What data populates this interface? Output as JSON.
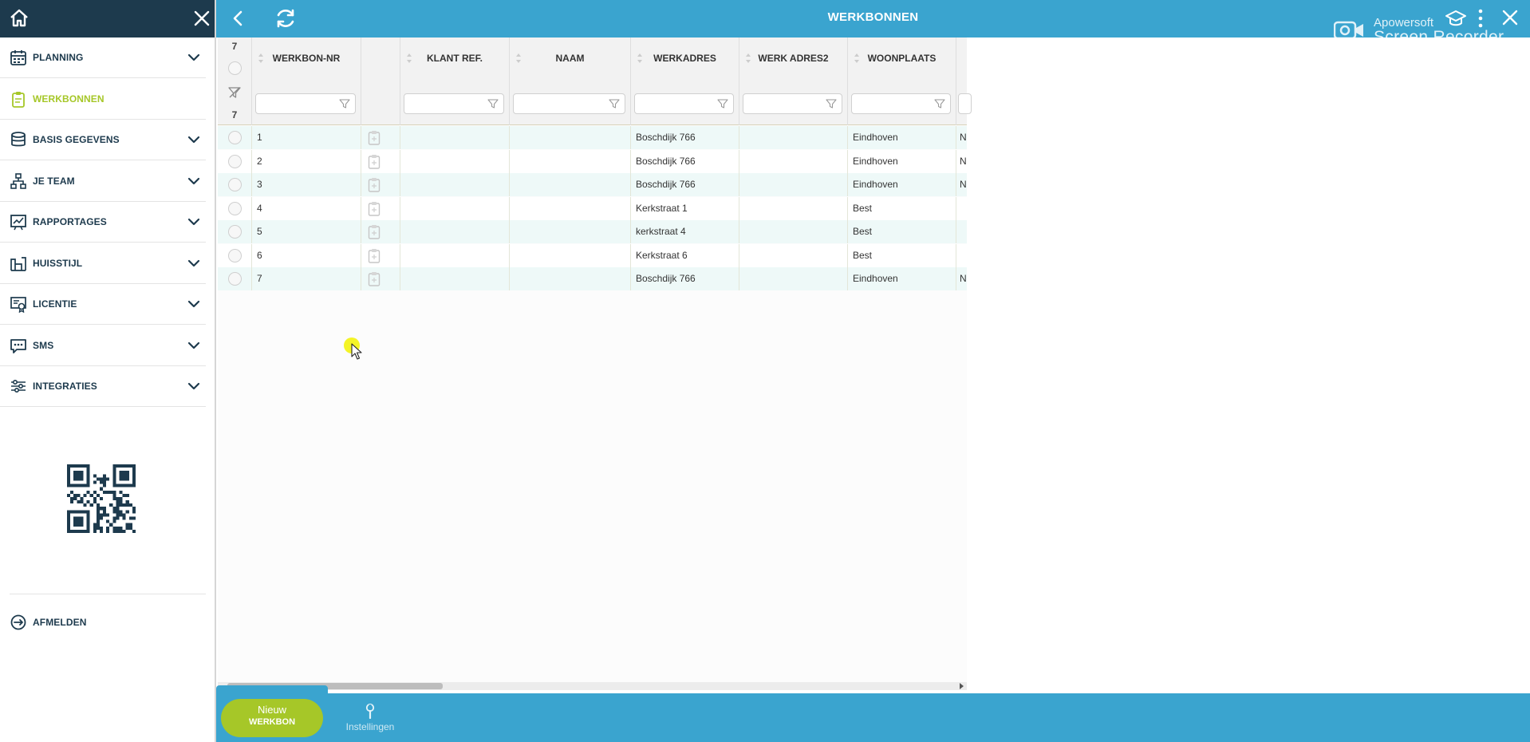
{
  "header": {
    "title": "WERKBONNEN"
  },
  "watermark": {
    "line1": "Apowersoft",
    "line2": "Screen Recorder"
  },
  "sidebar": {
    "items": [
      {
        "label": "PLANNING",
        "icon": "calendar-icon",
        "has_chevron": true
      },
      {
        "label": "WERKBONNEN",
        "icon": "clipboard-icon",
        "has_chevron": false,
        "active": true
      },
      {
        "label": "BASIS GEGEVENS",
        "icon": "database-icon",
        "has_chevron": true
      },
      {
        "label": "JE TEAM",
        "icon": "org-chart-icon",
        "has_chevron": true
      },
      {
        "label": "RAPPORTAGES",
        "icon": "report-icon",
        "has_chevron": true
      },
      {
        "label": "HUISSTIJL",
        "icon": "brand-icon",
        "has_chevron": true
      },
      {
        "label": "LICENTIE",
        "icon": "certificate-icon",
        "has_chevron": true
      },
      {
        "label": "SMS",
        "icon": "chat-icon",
        "has_chevron": true
      },
      {
        "label": "INTEGRATIES",
        "icon": "sliders-icon",
        "has_chevron": true
      }
    ],
    "logout_label": "AFMELDEN"
  },
  "grid": {
    "total_count": "7",
    "filtered_count": "7",
    "columns": [
      "WERKBON-NR",
      "",
      "KLANT REF.",
      "NAAM",
      "WERKADRES",
      "WERK ADRES2",
      "WOONPLAATS"
    ],
    "rows": [
      {
        "nr": "1",
        "klant_ref": "",
        "naam": "",
        "werkadres": "Boschdijk 766",
        "werkadres2": "",
        "woonplaats": "Eindhoven",
        "extra": "N"
      },
      {
        "nr": "2",
        "klant_ref": "",
        "naam": "",
        "werkadres": "Boschdijk 766",
        "werkadres2": "",
        "woonplaats": "Eindhoven",
        "extra": "N"
      },
      {
        "nr": "3",
        "klant_ref": "",
        "naam": "",
        "werkadres": "Boschdijk 766",
        "werkadres2": "",
        "woonplaats": "Eindhoven",
        "extra": "N"
      },
      {
        "nr": "4",
        "klant_ref": "",
        "naam": "",
        "werkadres": "Kerkstraat 1",
        "werkadres2": "",
        "woonplaats": "Best",
        "extra": ""
      },
      {
        "nr": "5",
        "klant_ref": "",
        "naam": "",
        "werkadres": "kerkstraat 4",
        "werkadres2": "",
        "woonplaats": "Best",
        "extra": ""
      },
      {
        "nr": "6",
        "klant_ref": "",
        "naam": "",
        "werkadres": "Kerkstraat 6",
        "werkadres2": "",
        "woonplaats": "Best",
        "extra": ""
      },
      {
        "nr": "7",
        "klant_ref": "",
        "naam": "",
        "werkadres": "Boschdijk 766",
        "werkadres2": "",
        "woonplaats": "Eindhoven",
        "extra": "N"
      }
    ]
  },
  "footer": {
    "new_line1": "Nieuw",
    "new_line2": "WERKBON",
    "settings_label": "Instellingen"
  },
  "colors": {
    "sidebar_dark": "#1d3a4d",
    "topbar_blue": "#3aa4cf",
    "accent_green": "#a6c728",
    "row_tint": "#eef9f8"
  }
}
